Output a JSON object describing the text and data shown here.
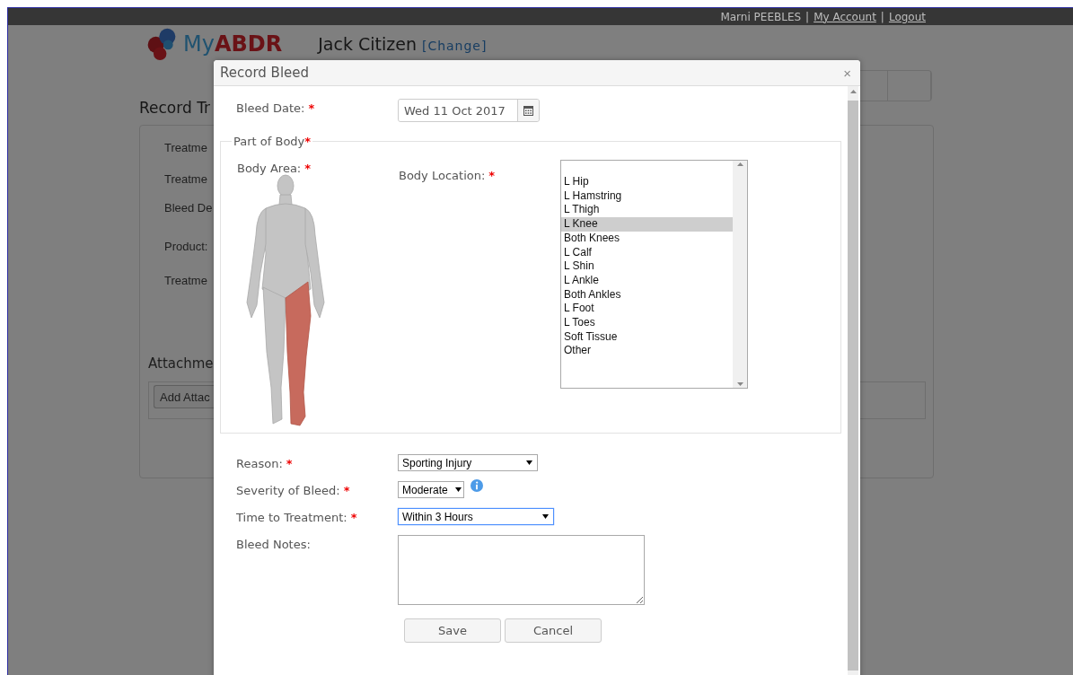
{
  "top_bar": {
    "items": [
      {
        "kind": "text",
        "text": "Marni PEEBLES"
      },
      {
        "kind": "separator",
        "text": "|"
      },
      {
        "kind": "link",
        "text": "My Account"
      },
      {
        "kind": "separator",
        "text": "|"
      },
      {
        "kind": "link",
        "text": "Logout"
      }
    ]
  },
  "background_page": {
    "logo": "My**ABDR**",
    "patient_name": "Jack Citizen",
    "change_link": "[Change]",
    "heading": "Record Tr",
    "form_labels": [
      "Treatme",
      "Treatme",
      "Bleed De",
      "Product:",
      "Treatme"
    ],
    "attachments_heading": "Attachme",
    "add_attachment_button": "Add Attac"
  },
  "modal": {
    "title": "Record Bleed",
    "close": "×",
    "bleed_date": {
      "label": "Bleed Date:",
      "required_mark": "*",
      "value": "Wed 11 Oct 2017"
    },
    "part_of_body": {
      "legend": "Part of Body",
      "legend_mark": "*",
      "body_area": {
        "label": "Body Area:",
        "required_mark": "*"
      },
      "body_location": {
        "label": "Body Location:",
        "required_mark": "*"
      },
      "locations": [
        {
          "label": "L Hip",
          "selected": false
        },
        {
          "label": "L Hamstring",
          "selected": false
        },
        {
          "label": "L Thigh",
          "selected": false
        },
        {
          "label": "L Knee",
          "selected": true
        },
        {
          "label": "Both Knees",
          "selected": false
        },
        {
          "label": "L Calf",
          "selected": false
        },
        {
          "label": "L Shin",
          "selected": false
        },
        {
          "label": "L Ankle",
          "selected": false
        },
        {
          "label": "Both Ankles",
          "selected": false
        },
        {
          "label": "L Foot",
          "selected": false
        },
        {
          "label": "L Toes",
          "selected": false
        },
        {
          "label": "Soft Tissue",
          "selected": false
        },
        {
          "label": "Other",
          "selected": false
        }
      ]
    },
    "selects": [
      {
        "label": "Reason:",
        "required_mark": "*",
        "value": "Sporting Injury",
        "focused": false,
        "info": false
      },
      {
        "label": "Severity of Bleed:",
        "required_mark": "*",
        "value": "Moderate",
        "focused": false,
        "info": true
      },
      {
        "label": "Time to Treatment:",
        "required_mark": "*",
        "value": "Within 3 Hours",
        "focused": true,
        "info": false
      }
    ],
    "notes": {
      "label": "Bleed Notes:"
    },
    "buttons": [
      "Save",
      "Cancel"
    ]
  }
}
